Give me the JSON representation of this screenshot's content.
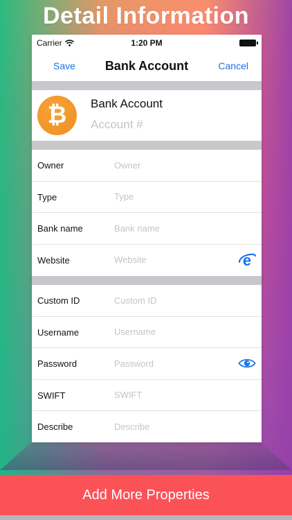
{
  "headline": "Detail Information",
  "status_bar": {
    "carrier": "Carrier",
    "time": "1:20 PM"
  },
  "nav": {
    "save_label": "Save",
    "title": "Bank Account",
    "cancel_label": "Cancel"
  },
  "header": {
    "coin_symbol": "₿",
    "title": "Bank Account",
    "account_placeholder": "Account #"
  },
  "section1": [
    {
      "label": "Owner",
      "placeholder": "Owner"
    },
    {
      "label": "Type",
      "placeholder": "Type"
    },
    {
      "label": "Bank name",
      "placeholder": "Bank name"
    },
    {
      "label": "Website",
      "placeholder": "Website",
      "icon": "browser-e-icon"
    }
  ],
  "section2": [
    {
      "label": "Custom ID",
      "placeholder": "Custom ID"
    },
    {
      "label": "Username",
      "placeholder": "Username"
    },
    {
      "label": "Password",
      "placeholder": "Password",
      "icon": "eye-icon"
    },
    {
      "label": "SWIFT",
      "placeholder": "SWIFT"
    },
    {
      "label": "Describe",
      "placeholder": "Describe"
    }
  ],
  "bottom_button": "Add More Properties",
  "colors": {
    "accent_blue": "#1a73e8",
    "coin_orange": "#f39323",
    "bottom_red": "#fb5258",
    "separator_gray": "#c8c7cc"
  }
}
